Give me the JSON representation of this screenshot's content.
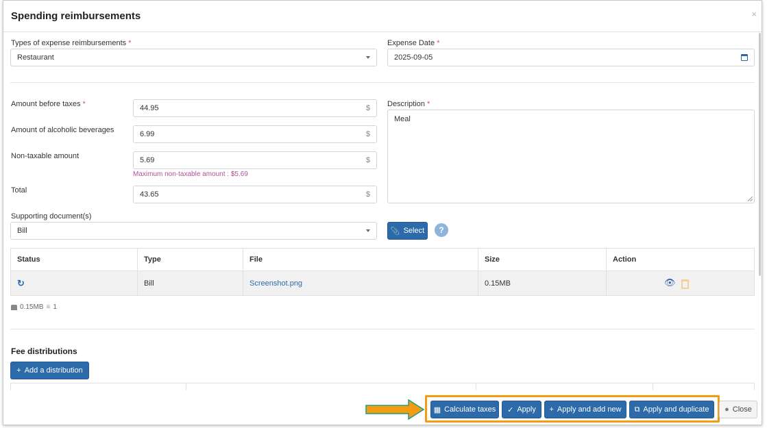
{
  "dialog": {
    "title": "Spending reimbursements",
    "close_glyph": "×"
  },
  "form": {
    "type_label": "Types of expense reimbursements",
    "type_value": "Restaurant",
    "date_label": "Expense Date",
    "date_value": "2025-09-05",
    "amount_label": "Amount before taxes",
    "amount_value": "44.95",
    "alcohol_label": "Amount of alcoholic beverages",
    "alcohol_value": "6.99",
    "nontax_label": "Non-taxable amount",
    "nontax_value": "5.69",
    "nontax_hint": "Maximum non-taxable amount : $5.69",
    "total_label": "Total",
    "total_value": "43.65",
    "currency": "$",
    "description_label": "Description",
    "description_value": "Meal",
    "required_mark": "*",
    "doc_label": "Supporting document(s)",
    "doc_value": "Bill",
    "select_button": "Select",
    "help_glyph": "?"
  },
  "documents": {
    "headers": {
      "status": "Status",
      "type": "Type",
      "file": "File",
      "size": "Size",
      "action": "Action"
    },
    "rows": [
      {
        "type": "Bill",
        "file": "Screenshot.png",
        "size": "0.15MB"
      }
    ],
    "total_size": "0.15MB",
    "count": "1"
  },
  "distributions": {
    "title": "Fee distributions",
    "add_button": "Add a distribution"
  },
  "footer": {
    "calc_taxes": "Calculate taxes",
    "apply": "Apply",
    "apply_add_new": "Apply and add new",
    "apply_duplicate": "Apply and duplicate",
    "close": "Close"
  },
  "colors": {
    "primary": "#2c6aa9",
    "highlight": "#f39c12",
    "hint": "#b34f9b",
    "required": "#d9534f"
  }
}
